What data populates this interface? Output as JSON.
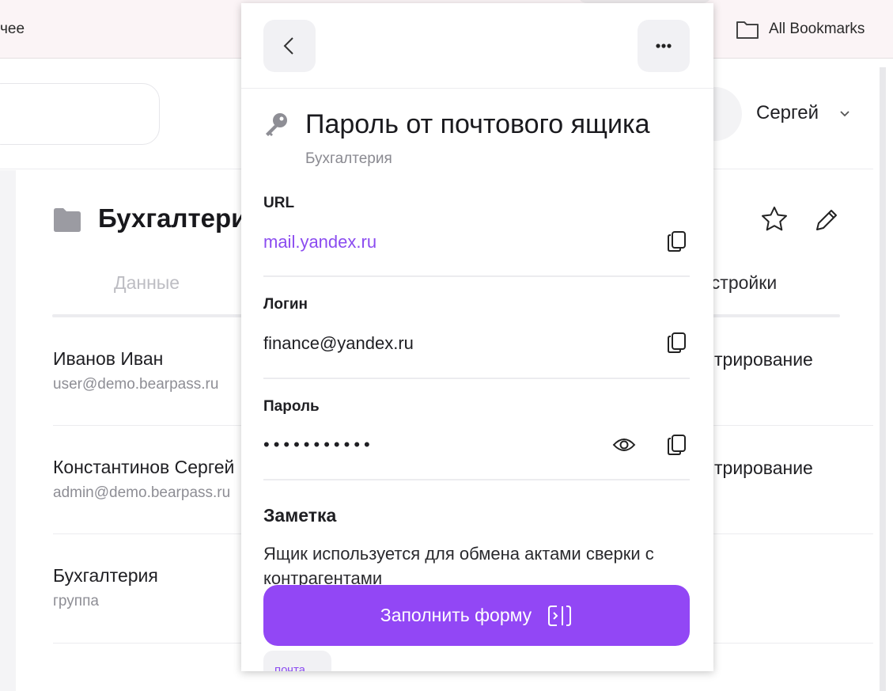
{
  "browser": {
    "tab_fragment": "чее",
    "bookmarks_label": "All Bookmarks"
  },
  "header": {
    "user_name": "Сергей"
  },
  "folder": {
    "title": "Бухгалтерия",
    "tabs": {
      "data": "Данные",
      "settings": "астройки"
    }
  },
  "members": [
    {
      "name": "Иванов Иван",
      "sub": "user@demo.bearpass.ru",
      "role": "трирование"
    },
    {
      "name": "Константинов Сергей",
      "sub": "admin@demo.bearpass.ru",
      "role": "трирование"
    },
    {
      "name": "Бухгалтерия",
      "sub": "группа",
      "role": ""
    }
  ],
  "popup": {
    "title": "Пароль от почтового ящика",
    "folder": "Бухгалтерия",
    "url_label": "URL",
    "url_value": "mail.yandex.ru",
    "login_label": "Логин",
    "login_value": "finance@yandex.ru",
    "password_label": "Пароль",
    "password_value": "•••••••••••",
    "note_label": "Заметка",
    "note_text": "Ящик используется для обмена актами сверки с контрагентами",
    "fill_button": "Заполнить форму",
    "tag": "почта"
  },
  "colors": {
    "accent": "#9247f5",
    "link": "#8b4cf0"
  }
}
